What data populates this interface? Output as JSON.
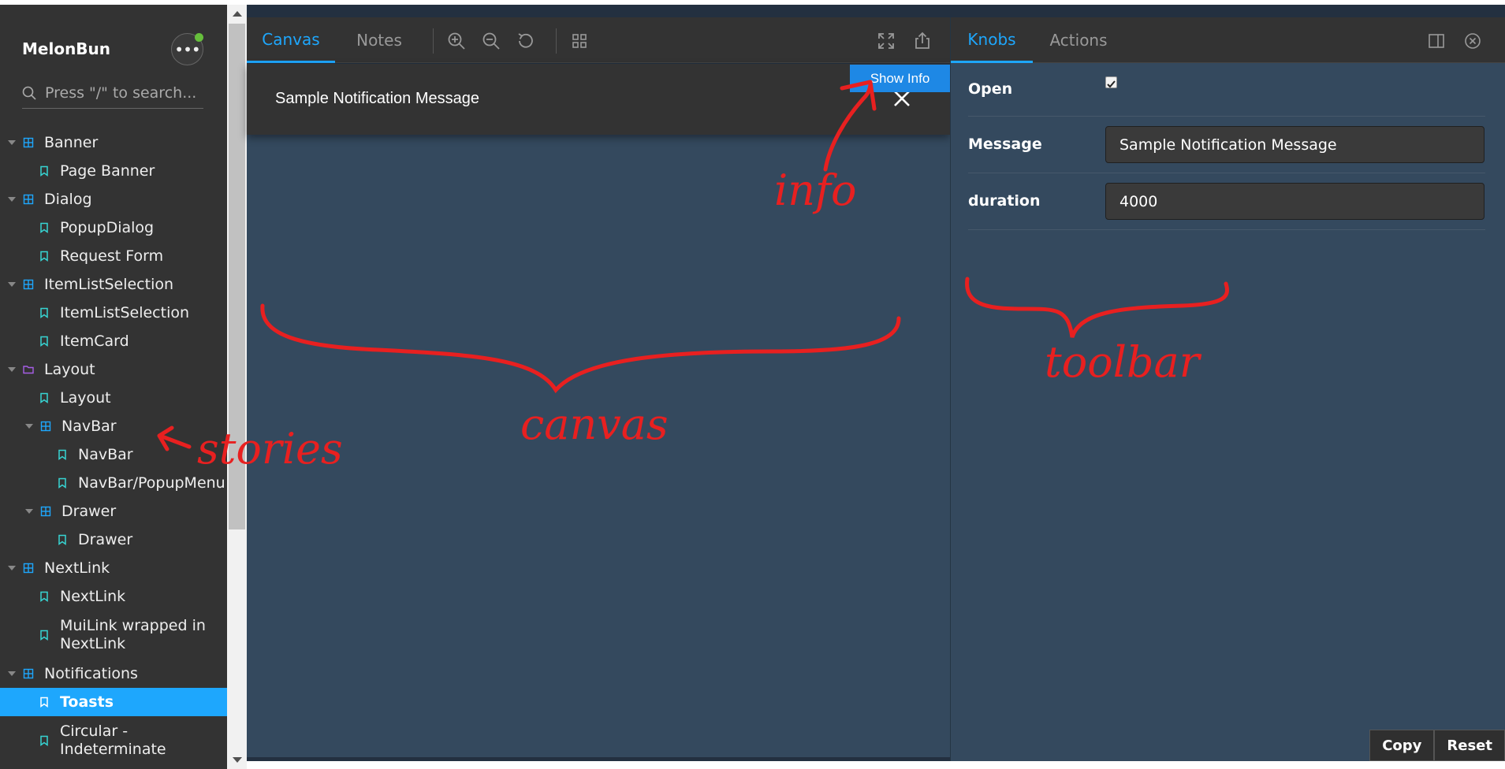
{
  "sidebar": {
    "brand": "MelonBun",
    "search_placeholder": "Press \"/\" to search...",
    "tree": [
      {
        "label": "Banner",
        "kind": "component",
        "level": 0
      },
      {
        "label": "Page Banner",
        "kind": "story",
        "level": 1
      },
      {
        "label": "Dialog",
        "kind": "component",
        "level": 0
      },
      {
        "label": "PopupDialog",
        "kind": "story",
        "level": 1
      },
      {
        "label": "Request Form",
        "kind": "story",
        "level": 1
      },
      {
        "label": "ItemListSelection",
        "kind": "component",
        "level": 0
      },
      {
        "label": "ItemListSelection",
        "kind": "story",
        "level": 1
      },
      {
        "label": "ItemCard",
        "kind": "story",
        "level": 1
      },
      {
        "label": "Layout",
        "kind": "folder",
        "level": 0
      },
      {
        "label": "Layout",
        "kind": "story",
        "level": 1
      },
      {
        "label": "NavBar",
        "kind": "component",
        "level": 1
      },
      {
        "label": "NavBar",
        "kind": "story",
        "level": 2
      },
      {
        "label": "NavBar/PopupMenu",
        "kind": "story",
        "level": 2
      },
      {
        "label": "Drawer",
        "kind": "component",
        "level": 1
      },
      {
        "label": "Drawer",
        "kind": "story",
        "level": 2
      },
      {
        "label": "NextLink",
        "kind": "component",
        "level": 0
      },
      {
        "label": "NextLink",
        "kind": "story",
        "level": 1
      },
      {
        "label": "MuiLink wrapped in NextLink",
        "kind": "story",
        "level": 1
      },
      {
        "label": "Notifications",
        "kind": "component",
        "level": 0
      },
      {
        "label": "Toasts",
        "kind": "story",
        "level": 1,
        "active": true
      },
      {
        "label": "Circular - Indeterminate",
        "kind": "story",
        "level": 1
      }
    ]
  },
  "preview": {
    "tabs": [
      "Canvas",
      "Notes"
    ],
    "active_tab": "Canvas",
    "toolbar_icons": [
      "zoom-in-icon",
      "zoom-out-icon",
      "zoom-reset-icon",
      "grid-icon",
      "fullscreen-icon",
      "share-icon"
    ],
    "toast_message": "Sample Notification Message",
    "show_info_label": "Show Info"
  },
  "addons": {
    "tabs": [
      "Knobs",
      "Actions"
    ],
    "active_tab": "Knobs",
    "knobs": [
      {
        "label": "Open",
        "type": "boolean",
        "value": true
      },
      {
        "label": "Message",
        "type": "text",
        "value": "Sample Notification Message"
      },
      {
        "label": "duration",
        "type": "number",
        "value": "4000"
      }
    ],
    "copy_label": "Copy",
    "reset_label": "Reset"
  },
  "annotations": {
    "info": "info",
    "canvas": "canvas",
    "toolbar": "toolbar",
    "stories": "stories"
  },
  "colors": {
    "accent": "#1ea7fd",
    "sidebar_bg": "#333333",
    "canvas_bg": "#34495e",
    "annotation": "#e82020",
    "show_info": "#1e88e5"
  }
}
